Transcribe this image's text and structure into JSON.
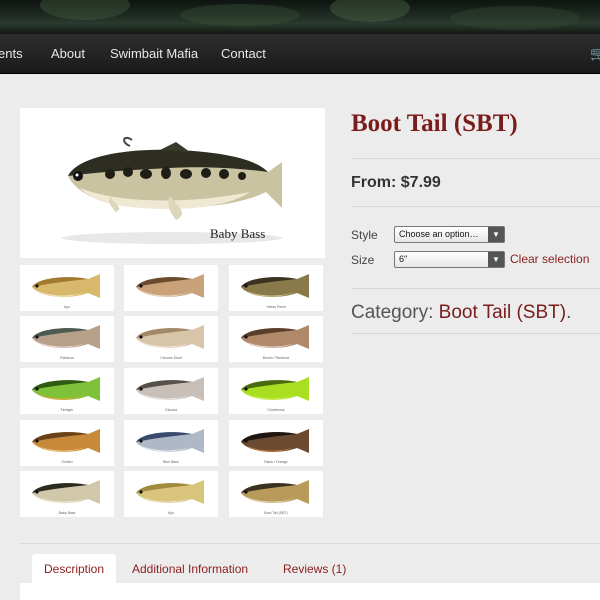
{
  "nav": {
    "items": [
      "ents",
      "About",
      "Swimbait Mafia",
      "Contact"
    ],
    "cart_icon": "cart-icon"
  },
  "gallery": {
    "main_caption": "Baby Bass",
    "thumbnails": [
      {
        "label": "Ayu",
        "body": "#d8b86a",
        "back": "#a07a30",
        "belly": "#f2e6c0"
      },
      {
        "label": "",
        "body": "#c9a27a",
        "back": "#6a4b2e",
        "belly": "#efe2cf"
      },
      {
        "label": "Yellow Perch",
        "body": "#8a7a4a",
        "back": "#3b3322",
        "belly": "#d8c48e"
      },
      {
        "label": "Rainbow",
        "body": "#b6a08a",
        "back": "#4c5a52",
        "belly": "#f0d8d0"
      },
      {
        "label": "Chrome Shad",
        "body": "#d8c4a8",
        "back": "#a08868",
        "belly": "#f5ede2"
      },
      {
        "label": "Brown / Rainbow",
        "body": "#b0886a",
        "back": "#5a3e2a",
        "belly": "#f0ddd4"
      },
      {
        "label": "Firetiger",
        "body": "#7fc23a",
        "back": "#2f5a14",
        "belly": "#f0a23a"
      },
      {
        "label": "Gizzard",
        "body": "#c8c0b8",
        "back": "#555049",
        "belly": "#f2eeea"
      },
      {
        "label": "Chartreuse",
        "body": "#a8e021",
        "back": "#4a6a10",
        "belly": "#d9f070"
      },
      {
        "label": "Golden",
        "body": "#c88a3a",
        "back": "#6a4018",
        "belly": "#f0cc8a"
      },
      {
        "label": "Blue Back",
        "body": "#aeb8c6",
        "back": "#3a4a6a",
        "belly": "#eef0f4"
      },
      {
        "label": "Black / Orange",
        "body": "#6a4a30",
        "back": "#1e1612",
        "belly": "#d0803a"
      },
      {
        "label": "Baby Bass",
        "body": "#d0c8a8",
        "back": "#2a2a1e",
        "belly": "#f2eed8"
      },
      {
        "label": "Ayu",
        "body": "#d8c47a",
        "back": "#a08a40",
        "belly": "#f2ead0"
      },
      {
        "label": "Boot Tail (SBT)",
        "body": "#b89a5a",
        "back": "#3a3020",
        "belly": "#e8dcb8"
      }
    ]
  },
  "product": {
    "title": "Boot Tail (SBT)",
    "price": "From: $7.99",
    "style_label": "Style",
    "style_value": "Choose an option…",
    "size_label": "Size",
    "size_value": "6\"",
    "clear_label": "Clear selection",
    "category_label": "Category:",
    "category_link": "Boot Tail (SBT)",
    "category_suffix": "."
  },
  "tabs": [
    "Description",
    "Additional Information",
    "Reviews (1)"
  ],
  "colors": {
    "accent": "#7a1c1c",
    "nav_bg": "#1a1a1a",
    "page_bg": "#ececec"
  }
}
